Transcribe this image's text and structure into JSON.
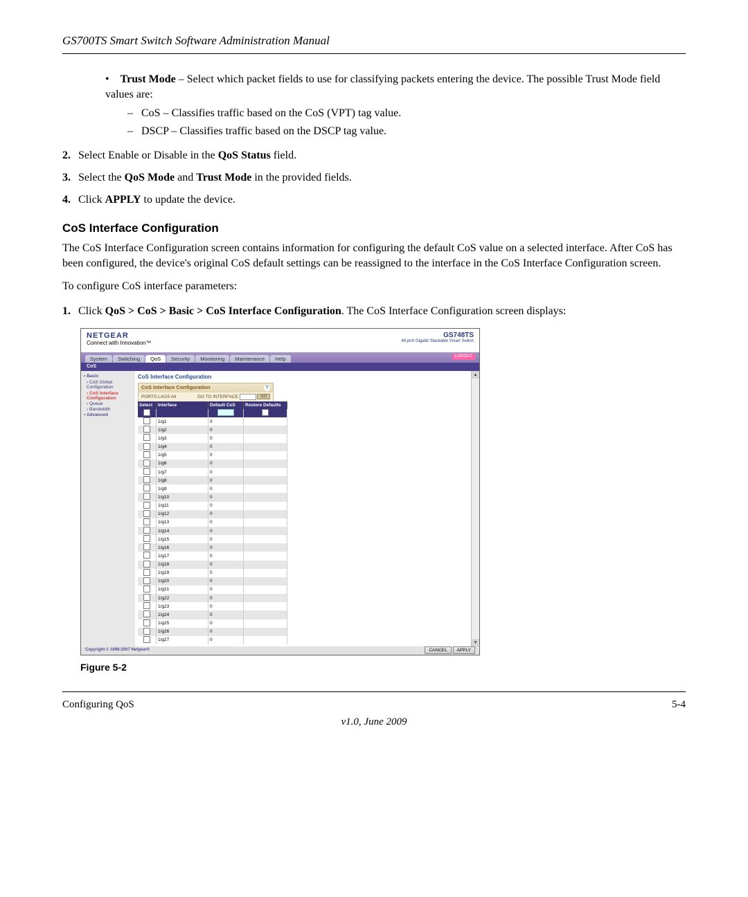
{
  "header": {
    "title": "GS700TS Smart Switch Software Administration Manual"
  },
  "body": {
    "trust_mode_intro_b": "Trust Mode",
    "trust_mode_intro": " – Select which packet fields to use for classifying packets entering the device. The possible Trust Mode field values are:",
    "sub_cos": "CoS – Classifies traffic based on the CoS (VPT) tag value.",
    "sub_dscp": "DSCP – Classifies traffic based on the DSCP tag value.",
    "step2_pre": "Select Enable or Disable in the ",
    "step2_b": "QoS Status",
    "step2_post": " field.",
    "step3_pre": "Select the ",
    "step3_b1": "QoS Mode",
    "step3_mid": " and ",
    "step3_b2": "Trust Mode",
    "step3_post": " in the provided fields.",
    "step4_pre": "Click ",
    "step4_b": "APPLY",
    "step4_post": " to update the device.",
    "section_heading": "CoS Interface Configuration",
    "section_para": "The CoS Interface Configuration screen contains information for configuring the default CoS value on a selected interface. After CoS has been configured, the device's original CoS default settings can be reassigned to the interface in the CoS Interface Configuration screen.",
    "config_intro": "To configure CoS interface parameters:",
    "step1b_pre": "Click ",
    "step1b_path": "QoS > CoS > Basic > CoS Interface Configuration",
    "step1b_post": ". The CoS Interface Configuration screen displays:"
  },
  "screenshot": {
    "logo": "NETGEAR",
    "logo_tag": "Connect with Innovation™",
    "model": "GS748TS",
    "model_sub": "48-port Gigabit Stackable Smart Switch",
    "tabs": [
      "System",
      "Switching",
      "QoS",
      "Security",
      "Monitoring",
      "Maintenance",
      "Help"
    ],
    "active_tab": "QoS",
    "subbar": "CoS",
    "logout": "LOGOUT",
    "side": {
      "group": "Basic",
      "links": [
        "CoS Global Configuration",
        "CoS Interface Configuration",
        "Queue",
        "Bandwidth"
      ],
      "advanced": "Advanced"
    },
    "panel": {
      "title": "CoS Interface Configuration",
      "box_title": "CoS Interface Configuration",
      "ports_label": "PORTS LAGS All",
      "go_label": "GO TO INTERFACE",
      "go_btn": "GO",
      "cols": {
        "select": "Select",
        "interface": "Interface",
        "default_cos": "Default CoS",
        "restore": "Restore Defaults"
      },
      "rows": [
        {
          "if": "1/g1",
          "dc": "0"
        },
        {
          "if": "1/g2",
          "dc": "0"
        },
        {
          "if": "1/g3",
          "dc": "0"
        },
        {
          "if": "1/g4",
          "dc": "0"
        },
        {
          "if": "1/g5",
          "dc": "0"
        },
        {
          "if": "1/g6",
          "dc": "0"
        },
        {
          "if": "1/g7",
          "dc": "0"
        },
        {
          "if": "1/g8",
          "dc": "0"
        },
        {
          "if": "1/g9",
          "dc": "0"
        },
        {
          "if": "1/g10",
          "dc": "0"
        },
        {
          "if": "1/g11",
          "dc": "0"
        },
        {
          "if": "1/g12",
          "dc": "0"
        },
        {
          "if": "1/g13",
          "dc": "0"
        },
        {
          "if": "1/g14",
          "dc": "0"
        },
        {
          "if": "1/g15",
          "dc": "0"
        },
        {
          "if": "1/g16",
          "dc": "0"
        },
        {
          "if": "1/g17",
          "dc": "0"
        },
        {
          "if": "1/g18",
          "dc": "0"
        },
        {
          "if": "1/g19",
          "dc": "0"
        },
        {
          "if": "1/g20",
          "dc": "0"
        },
        {
          "if": "1/g21",
          "dc": "0"
        },
        {
          "if": "1/g22",
          "dc": "0"
        },
        {
          "if": "1/g23",
          "dc": "0"
        },
        {
          "if": "1/g24",
          "dc": "0"
        },
        {
          "if": "1/g25",
          "dc": "0"
        },
        {
          "if": "1/g26",
          "dc": "0"
        },
        {
          "if": "1/g27",
          "dc": "0"
        }
      ]
    },
    "footer": {
      "copy": "Copyright © 1996-2007 Netgear®",
      "cancel": "CANCEL",
      "apply": "APPLY"
    }
  },
  "figure_caption": "Figure 5-2",
  "footer": {
    "left": "Configuring QoS",
    "right": "5-4",
    "version": "v1.0, June 2009"
  }
}
